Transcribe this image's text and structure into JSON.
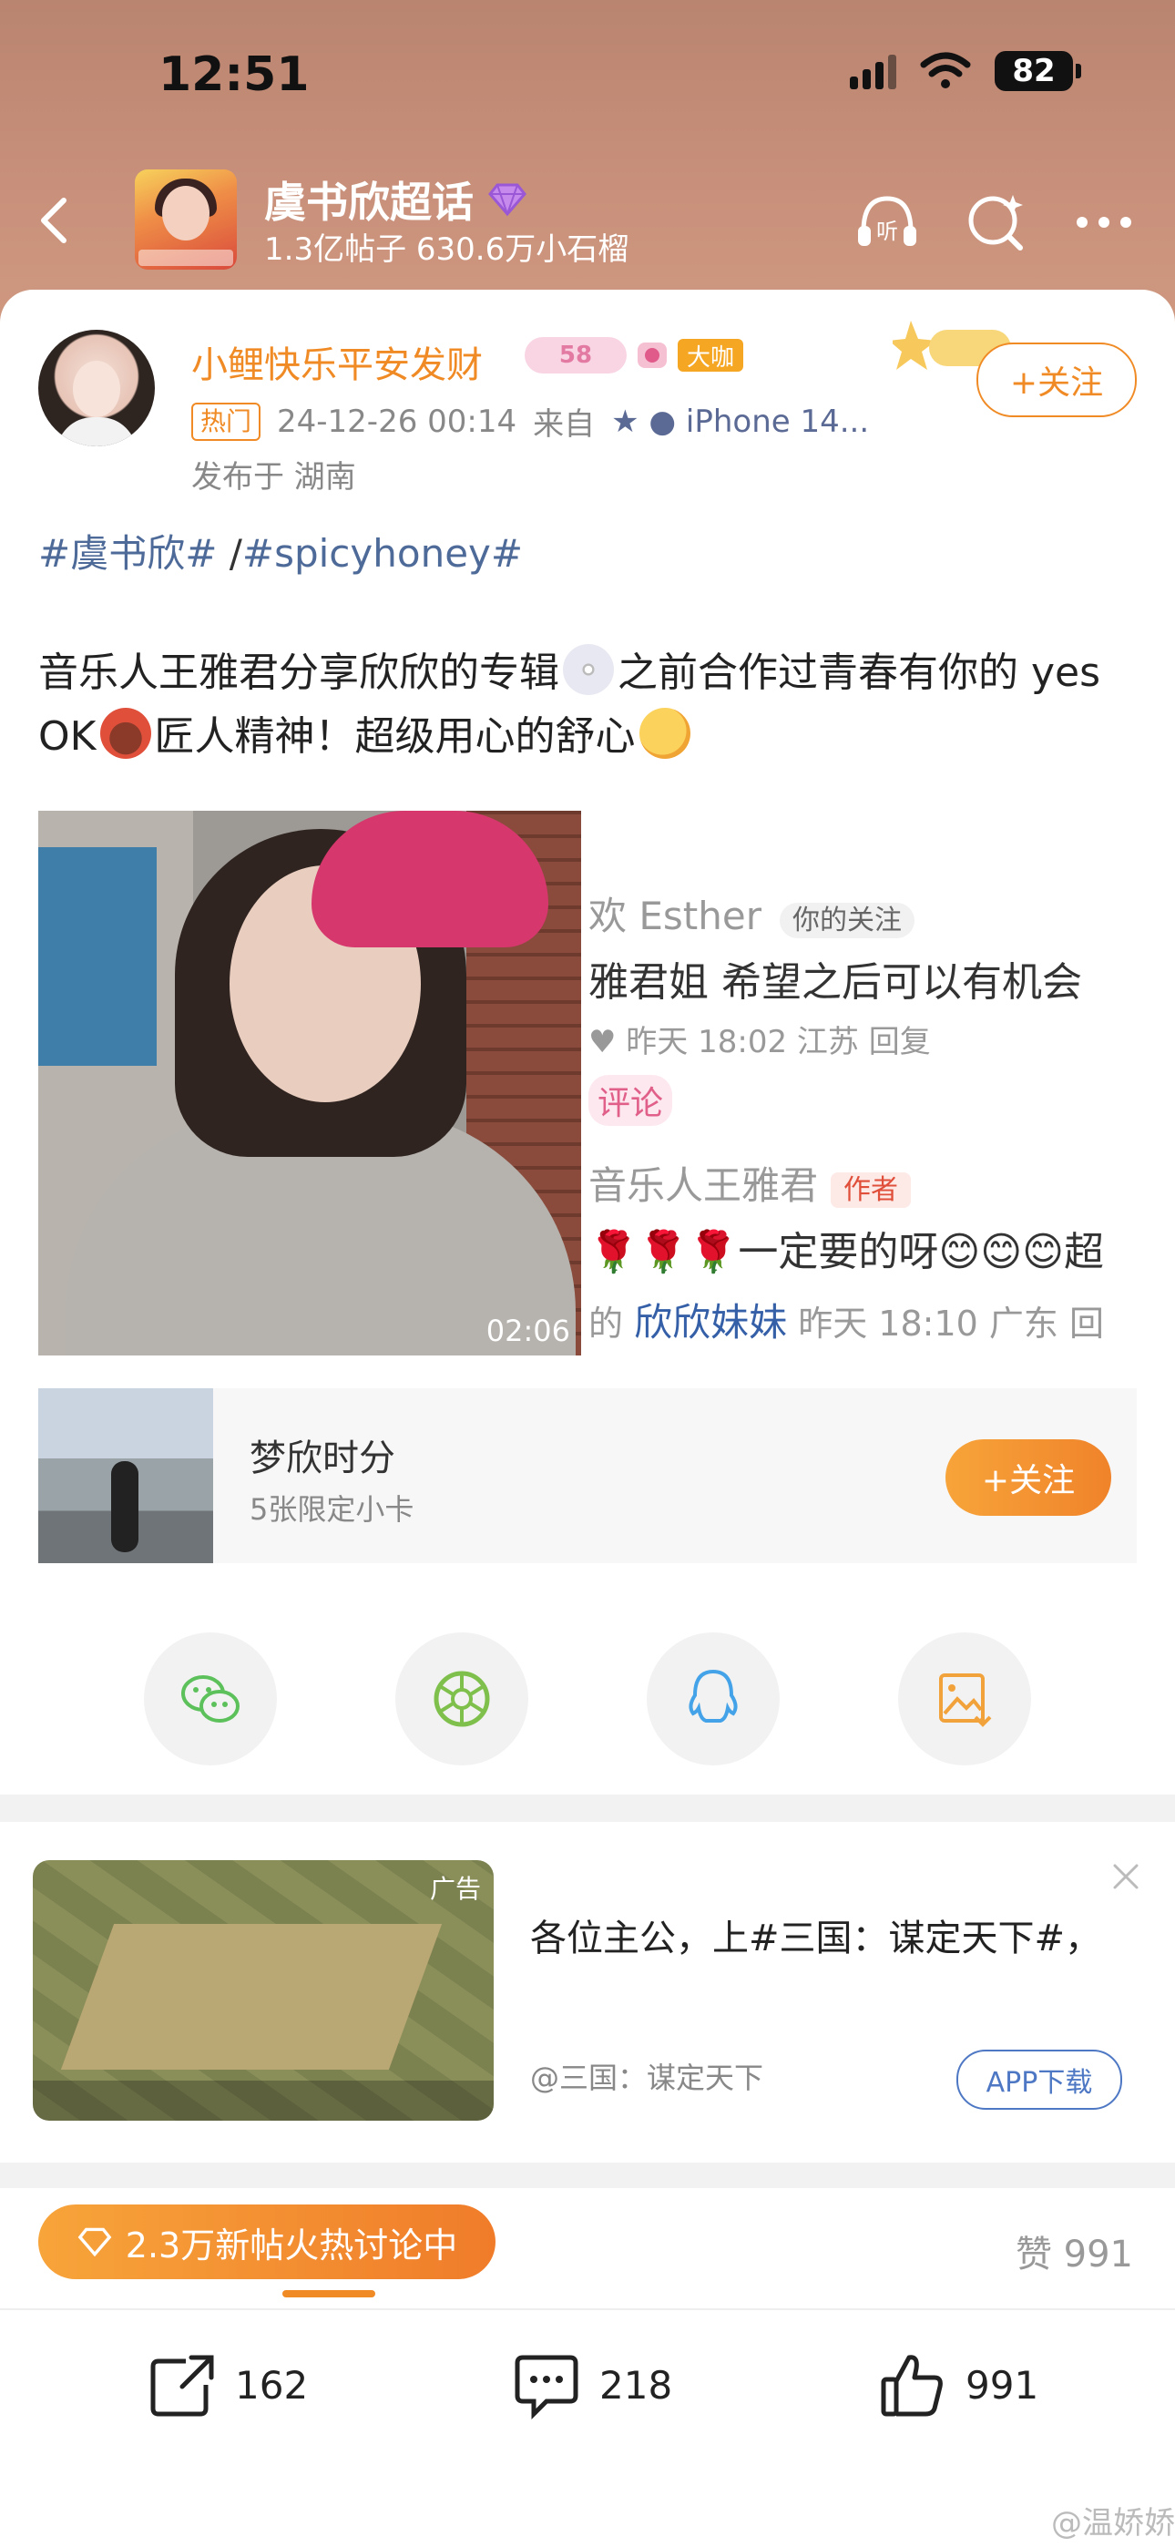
{
  "status_bar": {
    "time": "12:51",
    "battery": "82"
  },
  "topic": {
    "name": "虞书欣超话",
    "stats": "1.3亿帖子 630.6万小石榴"
  },
  "post": {
    "username": "小鲤快乐平安发财",
    "level_badge": "58",
    "role_badge": "大咖",
    "hot_tag": "热门",
    "timestamp": "24-12-26 00:14",
    "source_prefix": "来自",
    "device": "iPhone 14...",
    "location": "发布于 湖南",
    "follow_label": "+关注",
    "hashtag_1": "#虞书欣#",
    "hashtag_sep": " /",
    "hashtag_2": "#spicyhoney#",
    "text_part1": "音乐人王雅君分享欣欣的专辑",
    "text_part2": "之前合作过青春有你的 yes OK",
    "text_part3": "匠人精神！超级用心的舒心"
  },
  "media": {
    "video_duration": "02:06",
    "comment_screenshot": {
      "line1_name": "欢 Esther",
      "line1_tag": "你的关注",
      "line2": "雅君姐  希望之后可以有机会",
      "line3": "♥ 昨天 18:02 江苏 回复",
      "line4": "评论",
      "line5_name": "音乐人王雅君",
      "line5_tag": "作者",
      "line6": "🌹🌹🌹一定要的呀😊😊😊超",
      "line7_prefix": "的",
      "line7_name": "欣欣妹妹",
      "line7_suffix": " 昨天 18:10 广东 回"
    }
  },
  "fan_card": {
    "title": "梦欣时分",
    "subtitle": "5张限定小卡",
    "follow_label": "+关注"
  },
  "share": {
    "icons": [
      "wechat-icon",
      "moments-icon",
      "qq-icon",
      "save-image-icon"
    ]
  },
  "ad": {
    "label": "广告",
    "title": "各位主公，上#三国：谋定天下#，",
    "source": "@三国：谋定天下",
    "button": "APP下载"
  },
  "bottom": {
    "hot_pill": "2.3万新帖火热讨论中",
    "likes_label": "赞 991",
    "repost_count": "162",
    "comment_count": "218",
    "like_count": "991",
    "watermark": "@温娇娇"
  },
  "colors": {
    "accent": "#f08a24",
    "link": "#4e6a98",
    "header_bg": "#c38b76"
  }
}
